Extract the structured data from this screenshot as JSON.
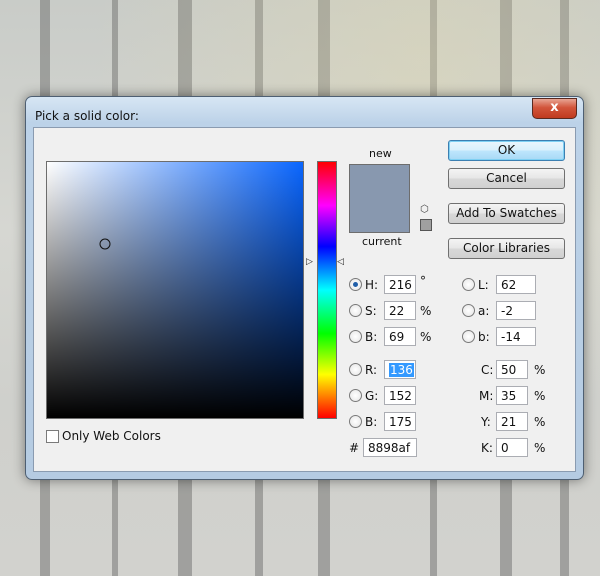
{
  "dialog": {
    "title": "Pick a solid color:",
    "close_glyph": "x"
  },
  "swatch": {
    "new_label": "new",
    "current_label": "current",
    "new_color": "#8898af",
    "current_color": "#8898af"
  },
  "buttons": {
    "ok": "OK",
    "cancel": "Cancel",
    "add_to_swatches": "Add To Swatches",
    "color_libraries": "Color Libraries"
  },
  "hsb": {
    "h_label": "H:",
    "h_value": "216",
    "h_unit": "°",
    "s_label": "S:",
    "s_value": "22",
    "s_unit": "%",
    "b_label": "B:",
    "b_value": "69",
    "b_unit": "%"
  },
  "rgb": {
    "r_label": "R:",
    "r_value": "136",
    "g_label": "G:",
    "g_value": "152",
    "b_label": "B:",
    "b_value": "175"
  },
  "lab": {
    "l_label": "L:",
    "l_value": "62",
    "a_label": "a:",
    "a_value": "-2",
    "b_label": "b:",
    "b_value": "-14"
  },
  "cmyk": {
    "c_label": "C:",
    "c_value": "50",
    "c_unit": "%",
    "m_label": "M:",
    "m_value": "35",
    "m_unit": "%",
    "y_label": "Y:",
    "y_value": "21",
    "y_unit": "%",
    "k_label": "K:",
    "k_value": "0",
    "k_unit": "%"
  },
  "hex": {
    "label": "#",
    "value": "8898af"
  },
  "web_colors": {
    "label": "Only Web Colors",
    "checked": false
  },
  "colors": {
    "accent": "#3399ff",
    "field_hue": "#0a66ff"
  }
}
